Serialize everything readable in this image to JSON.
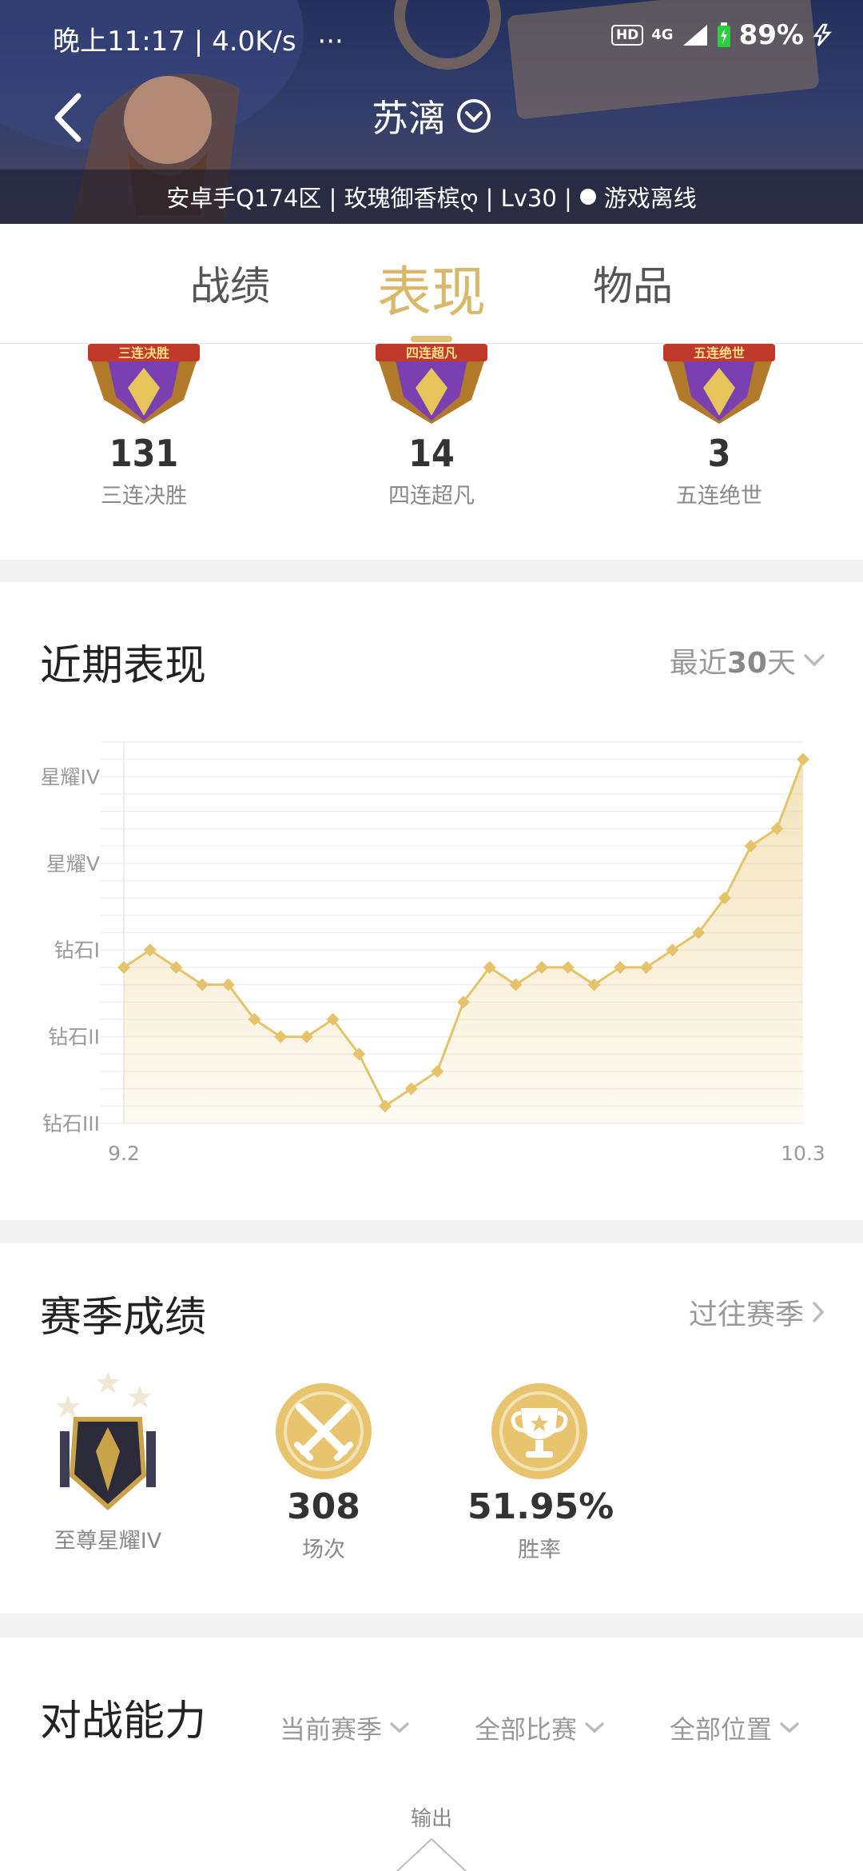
{
  "status_bar": {
    "time": "晚上11:17",
    "speed": "4.0K/s",
    "dots": "···",
    "hd": "HD",
    "network": "4G",
    "battery": "89",
    "battery_unit": "%"
  },
  "header": {
    "title": "苏漓",
    "server_info": "安卓手Q174区 | 玫瑰御香槟ღ | Lv30 |",
    "status_text": "游戏离线"
  },
  "tabs": [
    {
      "label": "战绩"
    },
    {
      "label": "表现"
    },
    {
      "label": "物品"
    }
  ],
  "medals": [
    {
      "badge": "三连决胜",
      "count": "131",
      "label": "三连决胜"
    },
    {
      "badge": "四连超凡",
      "count": "14",
      "label": "四连超凡"
    },
    {
      "badge": "五连绝世",
      "count": "3",
      "label": "五连绝世"
    }
  ],
  "recent": {
    "title": "近期表现",
    "range_prefix": "最近",
    "range_num": "30",
    "range_suffix": "天"
  },
  "chart_data": {
    "type": "area",
    "y_tick_labels": [
      "星耀IV",
      "星耀V",
      "钻石I",
      "钻石II",
      "钻石III"
    ],
    "y_tick_values": [
      4,
      3,
      2,
      1,
      0
    ],
    "x_tick_labels": [
      "9.2",
      "10.3"
    ],
    "ylim": [
      0,
      4.4
    ],
    "values": [
      1.8,
      2.0,
      1.8,
      1.6,
      1.6,
      1.2,
      1.0,
      1.0,
      1.2,
      0.8,
      0.2,
      0.4,
      0.6,
      1.4,
      1.8,
      1.6,
      1.8,
      1.8,
      1.6,
      1.8,
      1.8,
      2.0,
      2.2,
      2.6,
      3.2,
      3.4,
      4.2
    ],
    "color": "#e6c36a",
    "grid": true
  },
  "season": {
    "title": "赛季成绩",
    "link": "过往赛季",
    "rank_label": "至尊星耀IV",
    "matches": "308",
    "matches_label": "场次",
    "winrate": "51.95%",
    "winrate_label": "胜率"
  },
  "ability": {
    "title": "对战能力",
    "filters": [
      "当前赛季",
      "全部比赛",
      "全部位置"
    ],
    "radar_top": "输出"
  },
  "colors": {
    "accent": "#d9b86a",
    "gold": "#e6c36a"
  }
}
